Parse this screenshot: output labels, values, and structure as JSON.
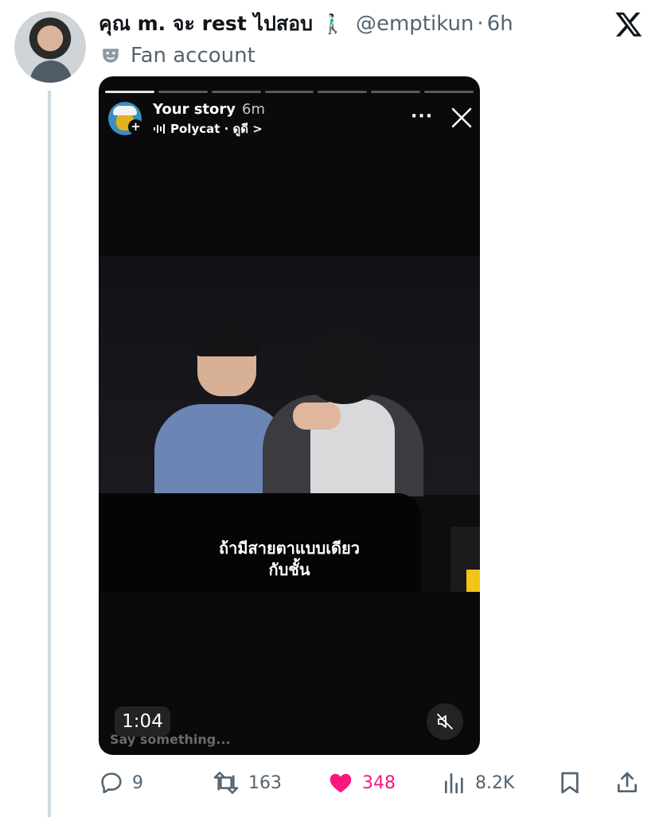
{
  "tweet": {
    "display_name": "คุณ m. จะ rest ไปสอบ",
    "emoji": "🚶🏻‍♂️",
    "handle": "@emptikun",
    "separator": "·",
    "time": "6h",
    "label": "Fan account"
  },
  "story": {
    "title": "Your story",
    "time": "6m",
    "audio_label": "Polycat · ดูดี >",
    "more": "···",
    "subtitle": "ถ้ามีสายตาแบบเดียว\nกับชั้น",
    "duration": "1:04",
    "reply_placeholder": "Say something...",
    "progress_segments": 7
  },
  "actions": {
    "replies": "9",
    "retweets": "163",
    "likes": "348",
    "views": "8.2K"
  },
  "colors": {
    "secondary_text": "#536471",
    "like_pink": "#f91880",
    "thread_line": "#cfd9de"
  },
  "icons": [
    "x-logo-icon",
    "mask-icon",
    "plus-icon",
    "audio-wave-icon",
    "more-icon",
    "close-icon",
    "mute-icon",
    "reply-icon",
    "retweet-icon",
    "heart-icon",
    "views-icon",
    "bookmark-icon",
    "share-icon"
  ]
}
